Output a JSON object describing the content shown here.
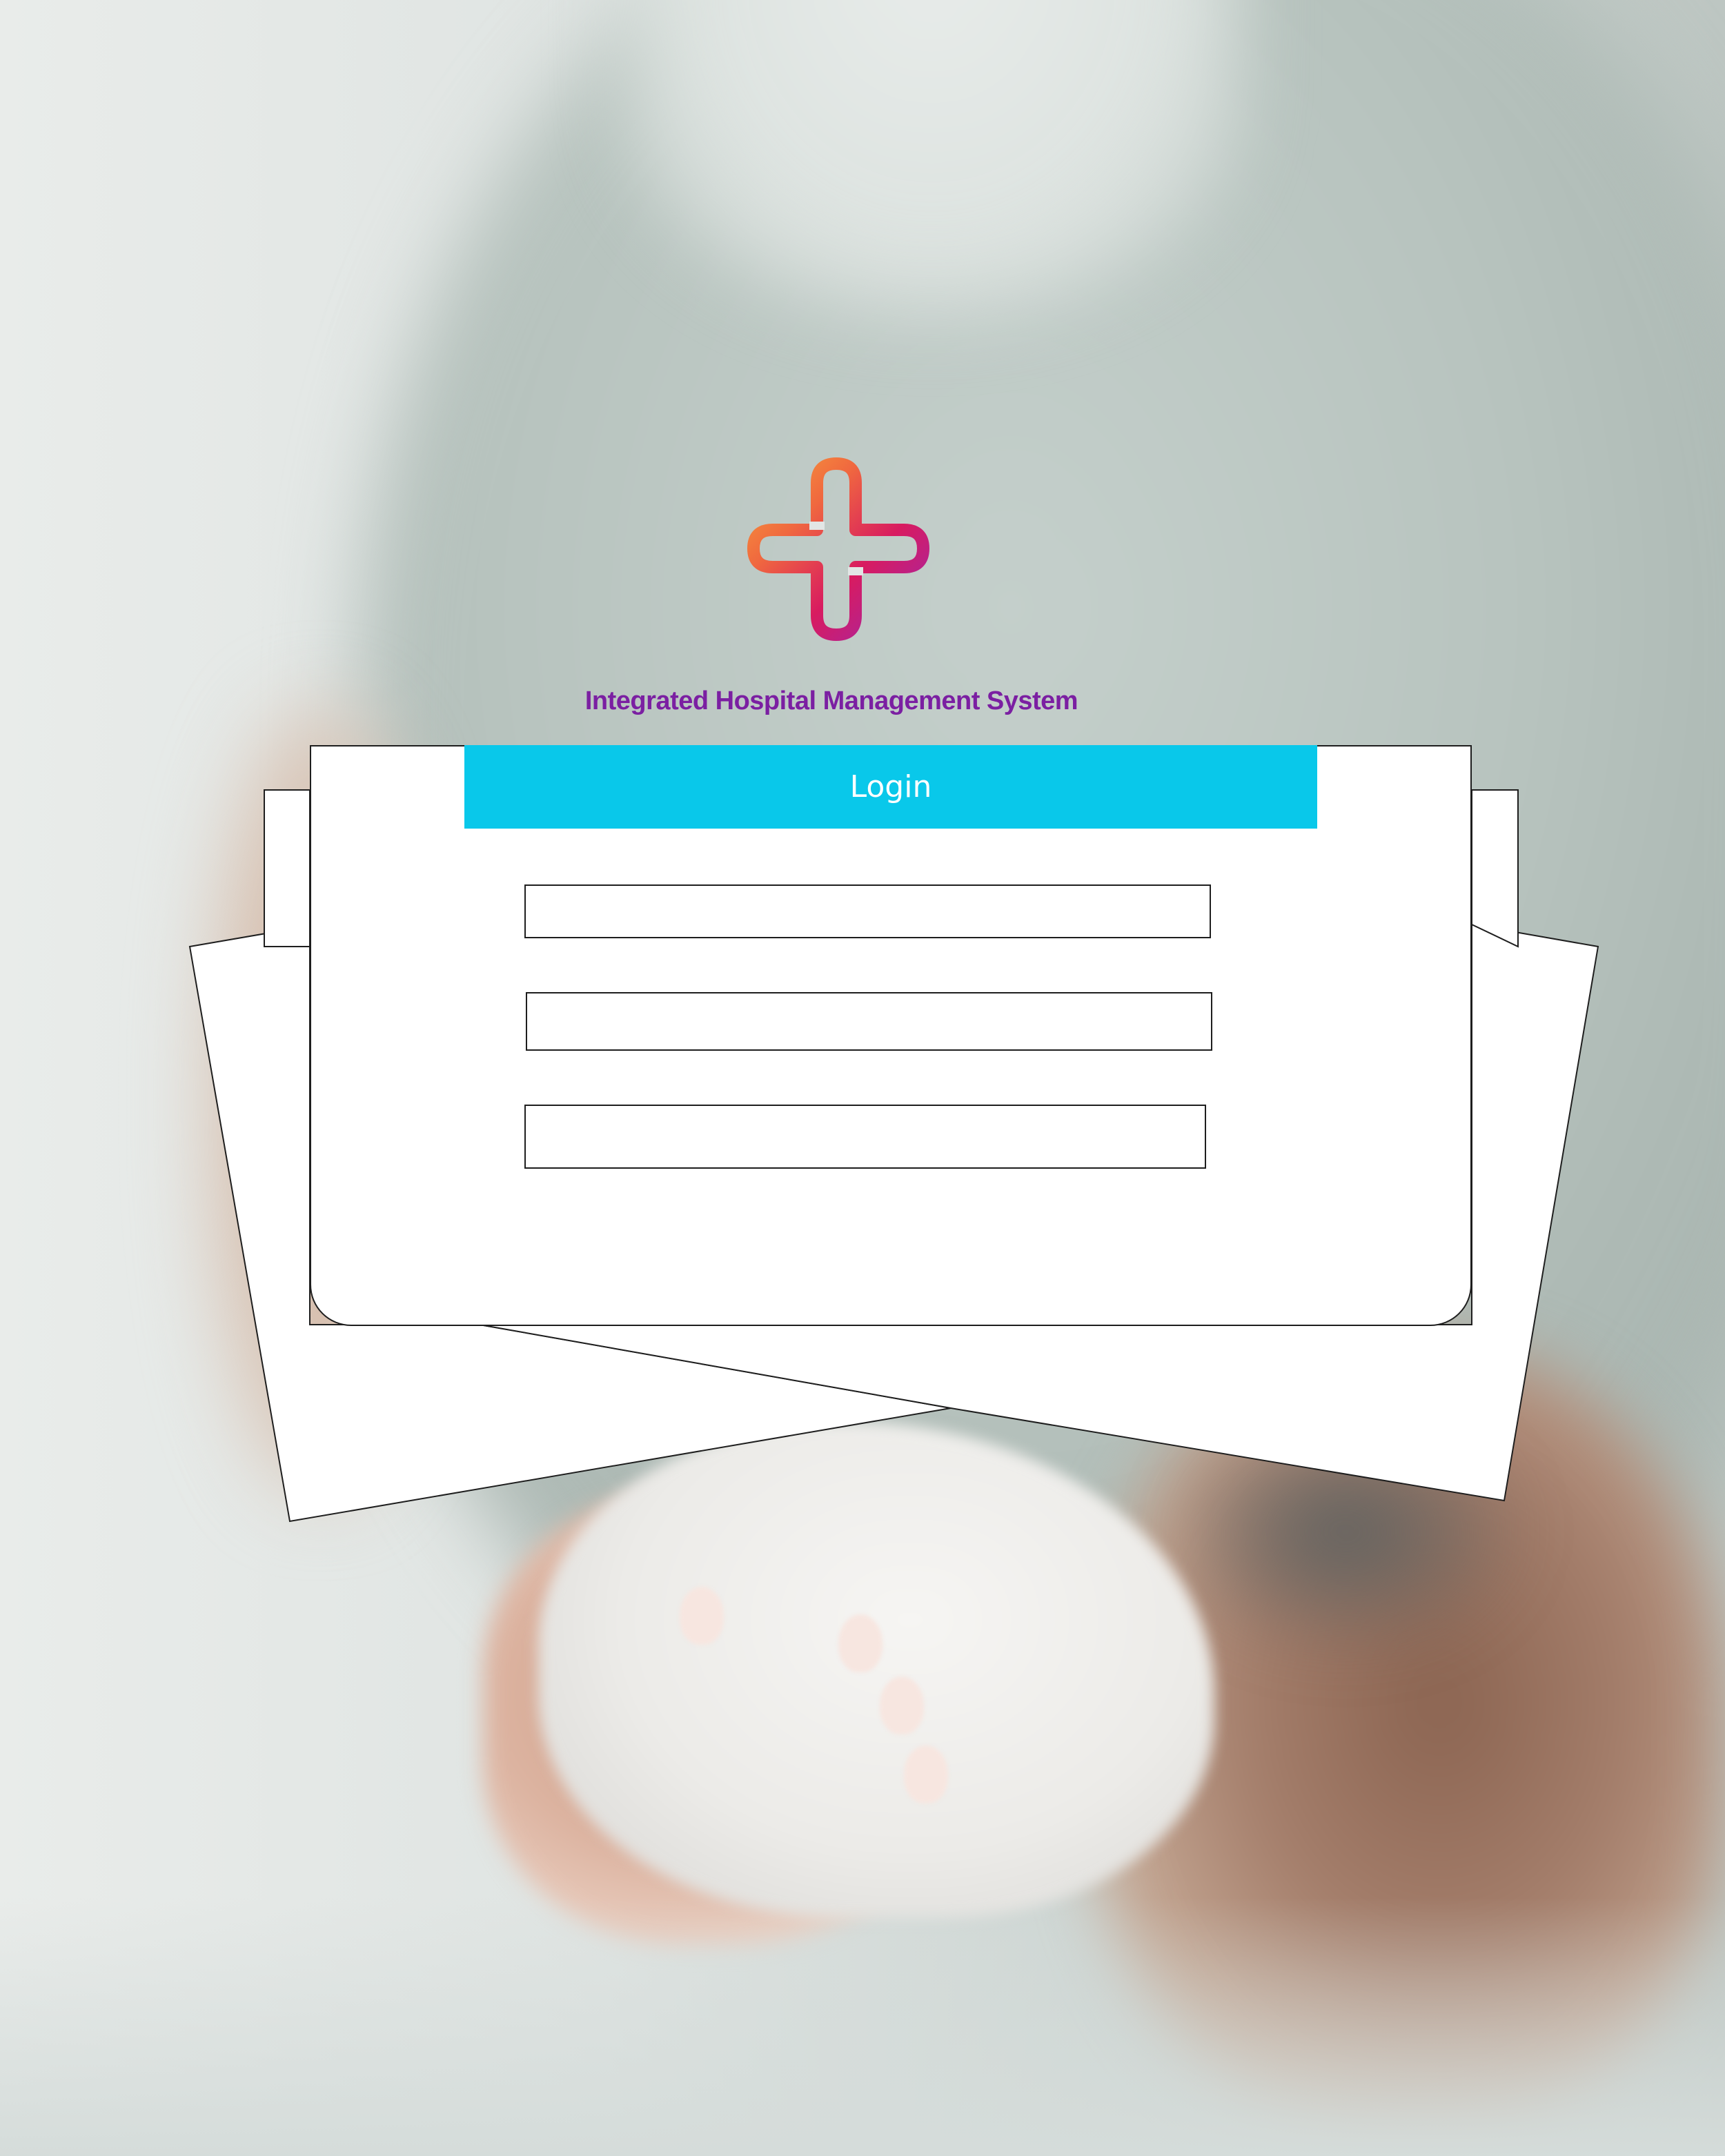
{
  "app": {
    "title": "Integrated Hospital Management System"
  },
  "login": {
    "header_label": "Login",
    "fields": [
      {
        "value": "",
        "placeholder": ""
      },
      {
        "value": "",
        "placeholder": ""
      },
      {
        "value": "",
        "placeholder": ""
      }
    ]
  },
  "icons": {
    "logo": "medical-cross-logo-icon"
  },
  "colors": {
    "accent": "#09c8ea",
    "title_text": "#7b1fa2",
    "logo_gradient_start": "#f58a3c",
    "logo_gradient_mid": "#d81b60",
    "logo_gradient_end": "#9c27b0",
    "card_border": "#1e1e1e"
  }
}
